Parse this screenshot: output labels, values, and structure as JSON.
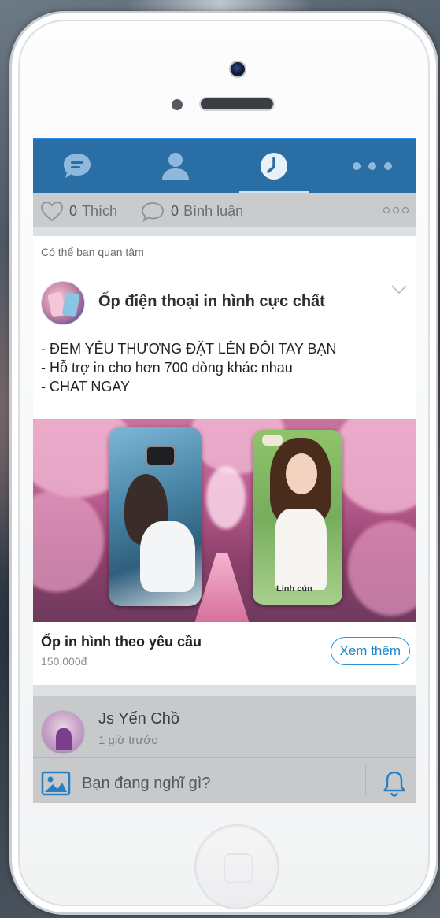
{
  "nav": {
    "items": [
      {
        "icon": "chat-icon"
      },
      {
        "icon": "contacts-icon"
      },
      {
        "icon": "timeline-clock-icon",
        "active": true
      },
      {
        "icon": "more-dots-icon"
      }
    ],
    "bar_color": "#2a6ea6"
  },
  "stats": {
    "likes_count": "0",
    "likes_label": "Thích",
    "comments_count": "0",
    "comments_label": "Bình luận"
  },
  "suggested": {
    "section_label": "Có thể bạn quan tâm",
    "title": "Ốp điện thoại in hình cực chất",
    "body": [
      "- ĐEM YÊU THƯƠNG ĐẶT LÊN ĐÔI TAY BẠN",
      "- Hỗ trợ in cho hơn 700 dòng khác nhau",
      "- CHAT NGAY"
    ],
    "image_caption": "Linh cún",
    "product_name": "Ốp in hình theo yêu cầu",
    "product_price": "150,000đ",
    "see_more_label": "Xem thêm",
    "accent_color": "#1c86c9"
  },
  "post": {
    "user_name": "Js Yến Chồ",
    "time": "1 giờ trước"
  },
  "composer": {
    "placeholder": "Bạn đang nghĩ gì?"
  }
}
